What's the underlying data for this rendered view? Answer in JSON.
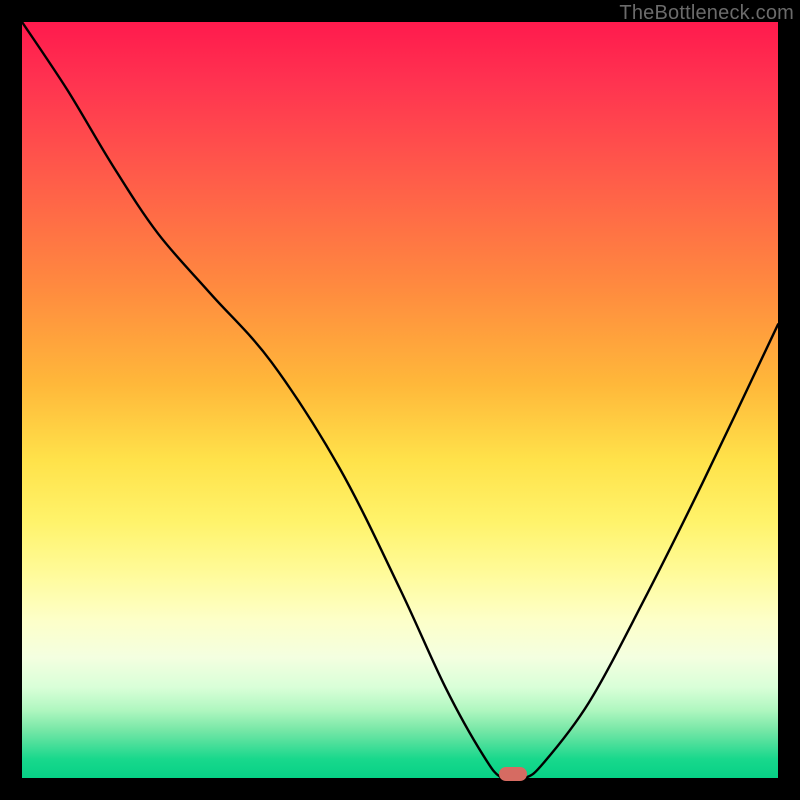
{
  "watermark": "TheBottleneck.com",
  "chart_data": {
    "type": "line",
    "title": "",
    "xlabel": "",
    "ylabel": "",
    "x_range": [
      0,
      100
    ],
    "y_range": [
      0,
      100
    ],
    "note": "Axes unlabeled; values estimated from pixel positions. y is bottleneck percentage (lower = better). Background gradient encodes severity: red≈100, green≈0. Marker denotes optimal point (valley minimum).",
    "series": [
      {
        "name": "bottleneck-curve",
        "x": [
          0,
          6,
          12,
          18,
          25,
          33,
          42,
          50,
          56,
          61,
          63.5,
          66.5,
          69,
          75,
          82,
          90,
          100
        ],
        "y": [
          100,
          91,
          81,
          72,
          64,
          55,
          41,
          25,
          12,
          3,
          0,
          0,
          2,
          10,
          23,
          39,
          60
        ]
      }
    ],
    "marker": {
      "x": 65,
      "y": 0,
      "color": "#d66b62"
    },
    "gradient_stops": [
      {
        "pct": 0,
        "color": "#ff1a4d"
      },
      {
        "pct": 50,
        "color": "#ffd94a"
      },
      {
        "pct": 80,
        "color": "#fdffc8"
      },
      {
        "pct": 100,
        "color": "#07d186"
      }
    ]
  }
}
